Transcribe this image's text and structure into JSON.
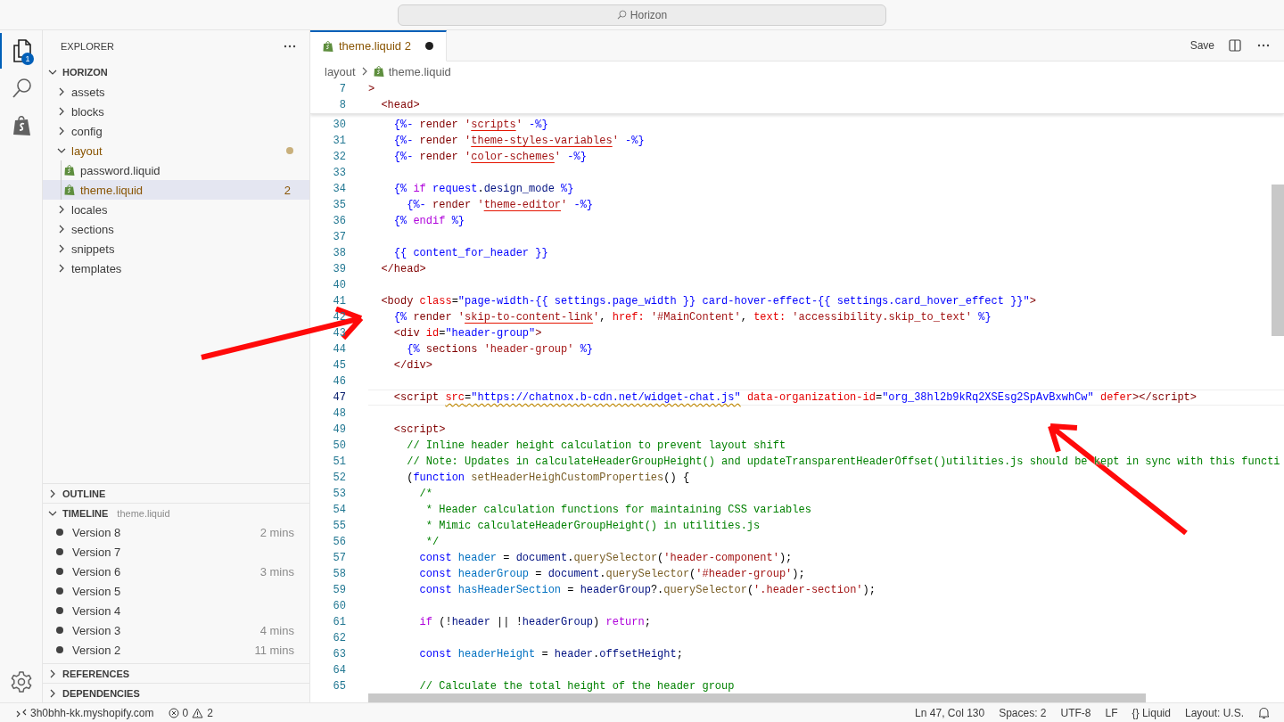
{
  "title_bar": {
    "search": "Horizon"
  },
  "activity_bar": {
    "items": [
      {
        "kind": "files",
        "selected": true,
        "badge": "1"
      },
      {
        "kind": "search",
        "selected": false
      },
      {
        "kind": "shopify",
        "selected": false
      }
    ]
  },
  "sidebar": {
    "title": "EXPLORER",
    "root": {
      "label": "HORIZON",
      "expanded": true
    },
    "tree": [
      {
        "label": "assets",
        "kind": "folder",
        "expanded": false,
        "selected": false,
        "warning": false
      },
      {
        "label": "blocks",
        "kind": "folder",
        "expanded": false,
        "selected": false,
        "warning": false
      },
      {
        "label": "config",
        "kind": "folder",
        "expanded": false,
        "selected": false,
        "warning": false
      },
      {
        "label": "layout",
        "kind": "folder",
        "expanded": true,
        "selected": false,
        "warning": true,
        "modified": true,
        "children": [
          {
            "label": "password.liquid",
            "kind": "file",
            "selected": false,
            "warning": false
          },
          {
            "label": "theme.liquid",
            "kind": "file",
            "selected": true,
            "warning": true,
            "badge": "2"
          }
        ]
      },
      {
        "label": "locales",
        "kind": "folder",
        "expanded": false,
        "selected": false,
        "warning": false
      },
      {
        "label": "sections",
        "kind": "folder",
        "expanded": false,
        "selected": false,
        "warning": false
      },
      {
        "label": "snippets",
        "kind": "folder",
        "expanded": false,
        "selected": false,
        "warning": false
      },
      {
        "label": "templates",
        "kind": "folder",
        "expanded": false,
        "selected": false,
        "warning": false
      }
    ],
    "outline": {
      "label": "OUTLINE",
      "expanded": false
    },
    "timeline": {
      "label": "TIMELINE",
      "file": "theme.liquid",
      "expanded": true,
      "items": [
        {
          "label": "Version 8",
          "time": "2 mins"
        },
        {
          "label": "Version 7"
        },
        {
          "label": "Version 6",
          "time": "3 mins"
        },
        {
          "label": "Version 5"
        },
        {
          "label": "Version 4"
        },
        {
          "label": "Version 3",
          "time": "4 mins"
        },
        {
          "label": "Version 2",
          "time": "11 mins"
        }
      ]
    },
    "references": {
      "label": "REFERENCES",
      "expanded": false
    },
    "dependencies": {
      "label": "DEPENDENCIES",
      "expanded": false
    }
  },
  "editor": {
    "tabs": [
      {
        "label": "theme.liquid",
        "problems": "2",
        "dirty": true,
        "selected": true
      }
    ],
    "actions": {
      "save": "Save"
    },
    "breadcrumb": [
      "layout",
      "theme.liquid"
    ],
    "sticky_lines": [
      {
        "number": "7",
        "current": false,
        "tokens": [
          {
            "kind": "tag",
            "text": ">"
          }
        ]
      },
      {
        "number": "8",
        "current": false,
        "tokens": [
          {
            "kind": "tag",
            "text": "  <head>"
          }
        ]
      }
    ],
    "lines": [
      {
        "number": "30",
        "current": false,
        "tokens": [
          {
            "kind": "liquid",
            "text": "    {%- "
          },
          {
            "kind": "tag",
            "text": "render "
          },
          {
            "kind": "lstring",
            "text": "'"
          },
          {
            "kind": "lstring",
            "text": "scripts",
            "error": true
          },
          {
            "kind": "lstring",
            "text": "' "
          },
          {
            "kind": "liquid",
            "text": "-%}"
          }
        ]
      },
      {
        "number": "31",
        "current": false,
        "tokens": [
          {
            "kind": "liquid",
            "text": "    {%- "
          },
          {
            "kind": "tag",
            "text": "render "
          },
          {
            "kind": "lstring",
            "text": "'"
          },
          {
            "kind": "lstring",
            "text": "theme-styles-variables",
            "error": true
          },
          {
            "kind": "lstring",
            "text": "' "
          },
          {
            "kind": "liquid",
            "text": "-%}"
          }
        ]
      },
      {
        "number": "32",
        "current": false,
        "tokens": [
          {
            "kind": "liquid",
            "text": "    {%- "
          },
          {
            "kind": "tag",
            "text": "render "
          },
          {
            "kind": "lstring",
            "text": "'"
          },
          {
            "kind": "lstring",
            "text": "color-schemes",
            "error": true
          },
          {
            "kind": "lstring",
            "text": "' "
          },
          {
            "kind": "liquid",
            "text": "-%}"
          }
        ]
      },
      {
        "number": "33",
        "current": false
      },
      {
        "number": "34",
        "current": false,
        "tokens": [
          {
            "kind": "liquid",
            "text": "    {% "
          },
          {
            "kind": "keyword",
            "text": "if "
          },
          {
            "kind": "liquid",
            "text": "request"
          },
          {
            "kind": "plain",
            "text": "."
          },
          {
            "kind": "variable",
            "text": "design_mode "
          },
          {
            "kind": "liquid",
            "text": "%}"
          }
        ]
      },
      {
        "number": "35",
        "current": false,
        "tokens": [
          {
            "kind": "liquid",
            "text": "      {%- "
          },
          {
            "kind": "tag",
            "text": "render "
          },
          {
            "kind": "lstring",
            "text": "'"
          },
          {
            "kind": "lstring",
            "text": "theme-editor",
            "error": true
          },
          {
            "kind": "lstring",
            "text": "' "
          },
          {
            "kind": "liquid",
            "text": "-%}"
          }
        ]
      },
      {
        "number": "36",
        "current": false,
        "tokens": [
          {
            "kind": "liquid",
            "text": "    {% "
          },
          {
            "kind": "keyword",
            "text": "endif "
          },
          {
            "kind": "liquid",
            "text": "%}"
          }
        ]
      },
      {
        "number": "37",
        "current": false
      },
      {
        "number": "38",
        "current": false,
        "tokens": [
          {
            "kind": "liquid",
            "text": "    {{ content_for_header }}"
          }
        ]
      },
      {
        "number": "39",
        "current": false,
        "tokens": [
          {
            "kind": "tag",
            "text": "  </head>"
          }
        ]
      },
      {
        "number": "40",
        "current": false
      },
      {
        "number": "41",
        "current": false,
        "tokens": [
          {
            "kind": "tag",
            "text": "  <body "
          },
          {
            "kind": "attribute",
            "text": "class"
          },
          {
            "kind": "plain",
            "text": "="
          },
          {
            "kind": "string",
            "text": "\"page-width-{{ settings.page_width }} card-hover-effect-{{ settings.card_hover_effect }}\""
          },
          {
            "kind": "tag",
            "text": ">"
          }
        ]
      },
      {
        "number": "42",
        "current": false,
        "tokens": [
          {
            "kind": "liquid",
            "text": "    {% "
          },
          {
            "kind": "tag",
            "text": "render "
          },
          {
            "kind": "lstring",
            "text": "'"
          },
          {
            "kind": "lstring",
            "text": "skip-to-content-link",
            "error": true
          },
          {
            "kind": "lstring",
            "text": "'"
          },
          {
            "kind": "plain",
            "text": ", "
          },
          {
            "kind": "attribute",
            "text": "href: "
          },
          {
            "kind": "lstring",
            "text": "'#MainContent'"
          },
          {
            "kind": "plain",
            "text": ", "
          },
          {
            "kind": "attribute",
            "text": "text: "
          },
          {
            "kind": "lstring",
            "text": "'accessibility.skip_to_text' "
          },
          {
            "kind": "liquid",
            "text": "%}"
          }
        ]
      },
      {
        "number": "43",
        "current": false,
        "tokens": [
          {
            "kind": "tag",
            "text": "    <div "
          },
          {
            "kind": "attribute",
            "text": "id"
          },
          {
            "kind": "plain",
            "text": "="
          },
          {
            "kind": "string",
            "text": "\"header-group\""
          },
          {
            "kind": "tag",
            "text": ">"
          }
        ]
      },
      {
        "number": "44",
        "current": false,
        "tokens": [
          {
            "kind": "liquid",
            "text": "      {% "
          },
          {
            "kind": "tag",
            "text": "sections "
          },
          {
            "kind": "lstring",
            "text": "'header-group' "
          },
          {
            "kind": "liquid",
            "text": "%}"
          }
        ]
      },
      {
        "number": "45",
        "current": false,
        "tokens": [
          {
            "kind": "tag",
            "text": "    </div>"
          }
        ]
      },
      {
        "number": "46",
        "current": false
      },
      {
        "number": "47",
        "current": true,
        "tokens": [
          {
            "kind": "tag",
            "text": "    <script "
          },
          {
            "kind": "attribute",
            "text": "src",
            "warning": true
          },
          {
            "kind": "plain",
            "text": "=",
            "warning": true
          },
          {
            "kind": "string",
            "text": "\"https://chatnox.b-cdn.net/widget-chat.js\"",
            "warning": true
          },
          {
            "kind": "attribute",
            "text": " data-organization-id"
          },
          {
            "kind": "plain",
            "text": "="
          },
          {
            "kind": "string",
            "text": "\"org_38hl2b9kRq2XSEsg2SpAvBxwhCw\""
          },
          {
            "kind": "attribute",
            "text": " defer"
          },
          {
            "kind": "tag",
            "text": "></script>"
          }
        ]
      },
      {
        "number": "48",
        "current": false
      },
      {
        "number": "49",
        "current": false,
        "tokens": [
          {
            "kind": "tag",
            "text": "    <script>"
          }
        ]
      },
      {
        "number": "50",
        "current": false,
        "tokens": [
          {
            "kind": "comment",
            "text": "      // Inline header height calculation to prevent layout shift"
          }
        ]
      },
      {
        "number": "51",
        "current": false,
        "tokens": [
          {
            "kind": "comment",
            "text": "      // Note: Updates in calculateHeaderGroupHeight() and updateTransparentHeaderOffset()utilities.js should be kept in sync with this functi"
          }
        ]
      },
      {
        "number": "52",
        "current": false,
        "tokens": [
          {
            "kind": "plain",
            "text": "      ("
          },
          {
            "kind": "declaration",
            "text": "function "
          },
          {
            "kind": "function",
            "text": "setHeaderHeighCustomProperties"
          },
          {
            "kind": "plain",
            "text": "() {"
          }
        ]
      },
      {
        "number": "53",
        "current": false,
        "tokens": [
          {
            "kind": "comment",
            "text": "        /*"
          }
        ]
      },
      {
        "number": "54",
        "current": false,
        "tokens": [
          {
            "kind": "comment",
            "text": "         * Header calculation functions for maintaining CSS variables"
          }
        ]
      },
      {
        "number": "55",
        "current": false,
        "tokens": [
          {
            "kind": "comment",
            "text": "         * Mimic calculateHeaderGroupHeight() in utilities.js"
          }
        ]
      },
      {
        "number": "56",
        "current": false,
        "tokens": [
          {
            "kind": "comment",
            "text": "         */"
          }
        ]
      },
      {
        "number": "57",
        "current": false,
        "tokens": [
          {
            "kind": "declaration",
            "text": "        const "
          },
          {
            "kind": "constant",
            "text": "header"
          },
          {
            "kind": "plain",
            "text": " = "
          },
          {
            "kind": "variable",
            "text": "document"
          },
          {
            "kind": "plain",
            "text": "."
          },
          {
            "kind": "function",
            "text": "querySelector"
          },
          {
            "kind": "plain",
            "text": "("
          },
          {
            "kind": "lstring",
            "text": "'header-component'"
          },
          {
            "kind": "plain",
            "text": ");"
          }
        ]
      },
      {
        "number": "58",
        "current": false,
        "tokens": [
          {
            "kind": "declaration",
            "text": "        const "
          },
          {
            "kind": "constant",
            "text": "headerGroup"
          },
          {
            "kind": "plain",
            "text": " = "
          },
          {
            "kind": "variable",
            "text": "document"
          },
          {
            "kind": "plain",
            "text": "."
          },
          {
            "kind": "function",
            "text": "querySelector"
          },
          {
            "kind": "plain",
            "text": "("
          },
          {
            "kind": "lstring",
            "text": "'#header-group'"
          },
          {
            "kind": "plain",
            "text": ");"
          }
        ]
      },
      {
        "number": "59",
        "current": false,
        "tokens": [
          {
            "kind": "declaration",
            "text": "        const "
          },
          {
            "kind": "constant",
            "text": "hasHeaderSection"
          },
          {
            "kind": "plain",
            "text": " = "
          },
          {
            "kind": "variable",
            "text": "headerGroup"
          },
          {
            "kind": "plain",
            "text": "?."
          },
          {
            "kind": "function",
            "text": "querySelector"
          },
          {
            "kind": "plain",
            "text": "("
          },
          {
            "kind": "lstring",
            "text": "'.header-section'"
          },
          {
            "kind": "plain",
            "text": ");"
          }
        ]
      },
      {
        "number": "60",
        "current": false
      },
      {
        "number": "61",
        "current": false,
        "tokens": [
          {
            "kind": "keyword",
            "text": "        if "
          },
          {
            "kind": "plain",
            "text": "(!"
          },
          {
            "kind": "variable",
            "text": "header"
          },
          {
            "kind": "plain",
            "text": " || !"
          },
          {
            "kind": "variable",
            "text": "headerGroup"
          },
          {
            "kind": "plain",
            "text": ") "
          },
          {
            "kind": "keyword",
            "text": "return"
          },
          {
            "kind": "plain",
            "text": ";"
          }
        ]
      },
      {
        "number": "62",
        "current": false
      },
      {
        "number": "63",
        "current": false,
        "tokens": [
          {
            "kind": "declaration",
            "text": "        const "
          },
          {
            "kind": "constant",
            "text": "headerHeight"
          },
          {
            "kind": "plain",
            "text": " = "
          },
          {
            "kind": "variable",
            "text": "header"
          },
          {
            "kind": "plain",
            "text": "."
          },
          {
            "kind": "variable",
            "text": "offsetHeight"
          },
          {
            "kind": "plain",
            "text": ";"
          }
        ]
      },
      {
        "number": "64",
        "current": false
      },
      {
        "number": "65",
        "current": false,
        "tokens": [
          {
            "kind": "comment",
            "text": "        // Calculate the total height of the header group"
          }
        ]
      }
    ]
  },
  "status_bar": {
    "remote": "3h0bhh-kk.myshopify.com",
    "errors": "0",
    "warnings": "2",
    "position": "Ln 47, Col 130",
    "indentation": "Spaces: 2",
    "encoding": "UTF-8",
    "eol": "LF",
    "language": {
      "icon": "{}",
      "label": "Liquid"
    },
    "layout": "Layout: U.S."
  },
  "annotations": [
    {
      "kind": "arrow"
    },
    {
      "kind": "arrow"
    }
  ]
}
